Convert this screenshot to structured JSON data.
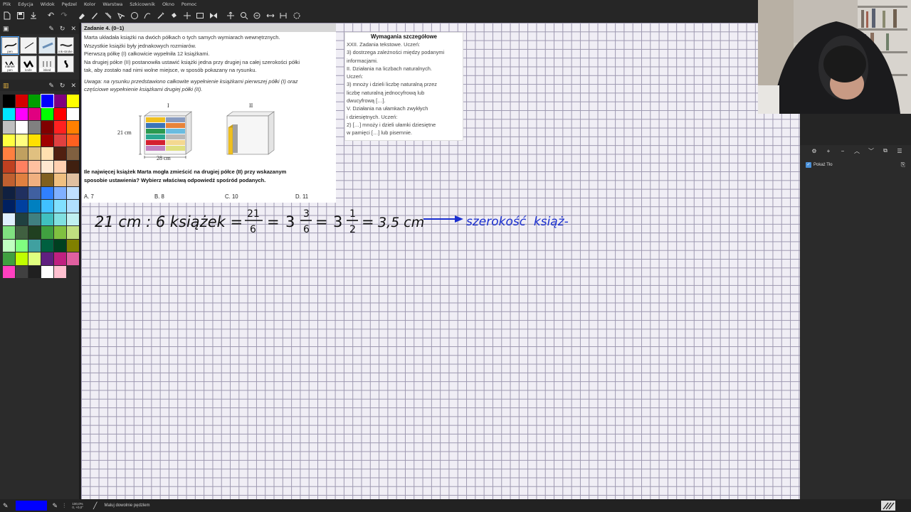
{
  "menu": [
    "Plik",
    "Edycja",
    "Widok",
    "Pędzel",
    "Kolor",
    "Warstwa",
    "Szkicownik",
    "Okno",
    "Pomoc"
  ],
  "toolbar_icons": [
    "new-file-icon",
    "save-icon",
    "export-icon",
    "undo-icon",
    "redo-icon",
    "eraser-icon",
    "pen-icon",
    "brush-icon",
    "lasso-icon",
    "ellipse-icon",
    "path-icon",
    "eyedropper-icon",
    "fill-icon",
    "transform-icon",
    "frame-icon",
    "symmetry-icon",
    "move-icon",
    "zoom-icon",
    "rotate-icon",
    "flip-icon",
    "pan-icon",
    "reset-icon"
  ],
  "brushes": [
    {
      "label": "pen"
    },
    {
      "label": ""
    },
    {
      "label": ""
    },
    {
      "label": "ink-stroke"
    },
    {
      "label": "marker pen"
    },
    {
      "label": "knife"
    },
    {
      "label": "inked"
    },
    {
      "label": ""
    }
  ],
  "palette": [
    "#000000",
    "#d40000",
    "#00a000",
    "#0000ff",
    "#800080",
    "#ffff00",
    "#00e5ff",
    "#ff00ff",
    "#e00080",
    "#00ff00",
    "#ff0000",
    "#ffffff",
    "#c0c0c0",
    "#ffffff",
    "#808080",
    "#800000",
    "#ff2020",
    "#ff8000",
    "#ffff40",
    "#ffff80",
    "#ffe000",
    "#a00000",
    "#e04040",
    "#ff6020",
    "#ff8040",
    "#c0a060",
    "#e0c080",
    "#ffe0b0",
    "#502010",
    "#806040",
    "#c04020",
    "#ff8060",
    "#ffc0a0",
    "#ffe8d0",
    "#ffd0b0",
    "#402010",
    "#c06030",
    "#e08040",
    "#f0b080",
    "#806020",
    "#f0c080",
    "#e0c0a0",
    "#102040",
    "#203060",
    "#4060a0",
    "#3080ff",
    "#80b0ff",
    "#c0e0ff",
    "#002060",
    "#0040a0",
    "#0080c0",
    "#40c0ff",
    "#80e0ff",
    "#b0e0ff",
    "#e0f0ff",
    "#204040",
    "#408080",
    "#40c0c0",
    "#80e0e0",
    "#c0f0f0",
    "#80e080",
    "#406040",
    "#204020",
    "#40a040",
    "#80c040",
    "#c0e080",
    "#c0ffc0",
    "#80ff80",
    "#40a0a0",
    "#006040",
    "#004020",
    "#808000",
    "#40a040",
    "#c0ff00",
    "#e0ff80",
    "#602080",
    "#c02080",
    "#e060a0",
    "#ff40c0",
    "#404040",
    "#202020",
    "#ffffff",
    "#ffc0d0"
  ],
  "task": {
    "header": "Zadanie 4. (0–1)",
    "lines": [
      "Marta układała książki na dwóch półkach o tych samych wymiarach wewnętrznych.",
      "Wszystkie książki były jednakowych rozmiarów.",
      "Pierwszą półkę (I) całkowicie wypełniła  12  książkami.",
      "Na drugiej półce (II) postanowiła ustawić książki jedna przy drugiej na całej szerokości półki",
      "tak, aby zostało nad nimi wolne miejsce, w sposób pokazany na rysunku."
    ],
    "note_lines": [
      "Uwaga: na rysunku przedstawiono całkowite wypełnienie książkami pierwszej półki (I) oraz",
      "częściowe wypełnienie książkami drugiej półki (II)."
    ],
    "figure": {
      "label_I": "I",
      "label_II": "II",
      "height": "21 cm",
      "width": "28 cm"
    },
    "question_lines": [
      "Ile najwięcej książek Marta mogła zmieścić na drugiej półce (II) przy wskazanym",
      "sposobie ustawienia? Wybierz właściwą odpowiedź spośród podanych."
    ],
    "answers": [
      "A.  7",
      "B.  8",
      "C.  10",
      "D.  11"
    ]
  },
  "requirements": {
    "title": "Wymagania szczegółowe",
    "lines": [
      "XXII. Zadania tekstowe. Uczeń:",
      "3) dostrzega zależności między podanymi",
      "informacjami.",
      "II. Działania na liczbach naturalnych.",
      "Uczeń:",
      "3) mnoży i dzieli liczbę naturalną przez",
      "liczbę naturalną jednocyfrową lub",
      "dwucyfrową […].",
      "V. Działania na ułamkach zwykłych",
      "i dziesiętnych. Uczeń:",
      "2) […] mnoży i dzieli ułamki dziesiętne",
      "w pamięci […] lub pisemnie."
    ]
  },
  "handwriting": {
    "start": "21 cm : 6 książek =",
    "frac1_num": "21",
    "frac1_den": "6",
    "eq": "=",
    "mixed1_whole": "3",
    "mixed1_num": "3",
    "mixed1_den": "6",
    "mixed2_whole": "3",
    "mixed2_num": "1",
    "mixed2_den": "2",
    "result": "3,5 cm",
    "blue_text": "szerokość  książ-",
    "ink_color": "#111111",
    "blue_color": "#1a2fd0"
  },
  "layers": {
    "items": [
      {
        "name": "Pokaż Tło",
        "visible": true
      }
    ]
  },
  "status": {
    "foreground_color": "#0000ff",
    "zoom": "100,0%",
    "pos": "0, +0,0°",
    "hint": "Maluj dowolnie pędzlem"
  }
}
